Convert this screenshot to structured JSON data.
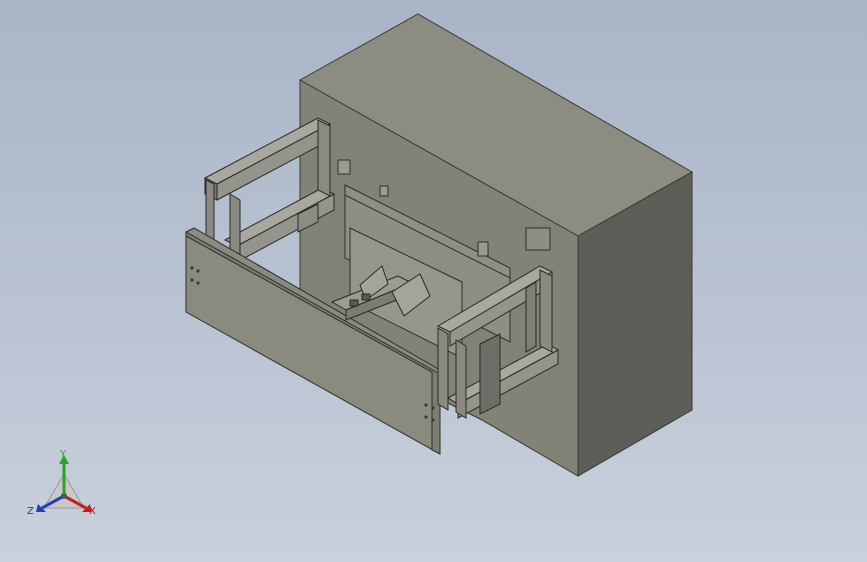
{
  "viewport": {
    "background_top": "#a9b6c8",
    "background_bottom": "#c9d1dc",
    "model_color": "#8a8a7e",
    "frame_color": "#9a9a92"
  },
  "triad": {
    "x_label": "X",
    "y_label": "Y",
    "z_label": "Z",
    "x_color": "#c02020",
    "y_color": "#2ea02e",
    "z_color": "#2040c0"
  }
}
